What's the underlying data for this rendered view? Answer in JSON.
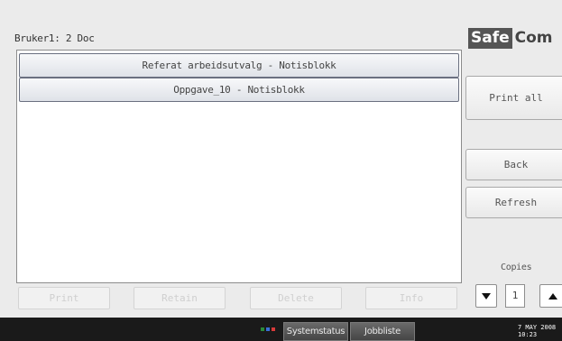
{
  "header": {
    "user_label": "Bruker1: 2 Doc",
    "logo_part1": "Safe",
    "logo_part2": "Com"
  },
  "documents": [
    {
      "name": "Referat arbeidsutvalg - Notisblokk"
    },
    {
      "name": "Oppgave_10 - Notisblokk"
    }
  ],
  "side_buttons": {
    "print_all": "Print all",
    "back": "Back",
    "refresh": "Refresh"
  },
  "copies": {
    "label": "Copies",
    "value": "1"
  },
  "actions": {
    "print": "Print",
    "retain": "Retain",
    "delete": "Delete",
    "info": "Info"
  },
  "status_bar": {
    "system_status": "Systemstatus",
    "job_list": "Jobbliste",
    "date": "7 MAY  2008",
    "time": "10:23",
    "indicator_colors": [
      "#2a8a3a",
      "#3a6fd8",
      "#d83a3a"
    ]
  }
}
